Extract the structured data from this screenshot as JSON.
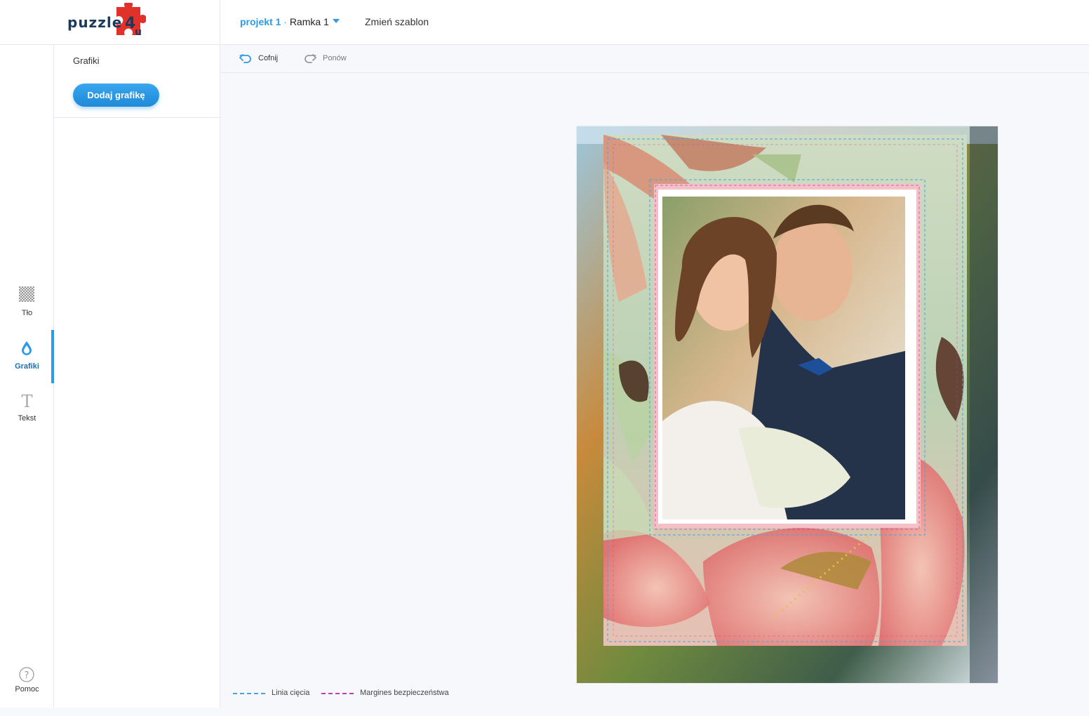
{
  "header": {
    "logo_alt": "puzzle4u",
    "project_label": "projekt 1",
    "separator": " · ",
    "frame_label": "Ramka 1",
    "change_template": "Zmień szablon"
  },
  "toolbar": {
    "undo": "Cofnij",
    "redo": "Ponów"
  },
  "leftnav": {
    "items": [
      {
        "label": "Tło",
        "icon": "checkerboard-icon"
      },
      {
        "label": "Grafiki",
        "icon": "drop-icon",
        "active": true
      },
      {
        "label": "Tekst",
        "icon": "text-icon"
      }
    ],
    "help": "Pomoc"
  },
  "panel": {
    "title": "Grafiki",
    "add_button": "Dodaj grafikę"
  },
  "legend": {
    "cut_line": "Linia cięcia",
    "safety_margin": "Margines bezpieczeństwa"
  },
  "colors": {
    "accent": "#2e9be6",
    "cut_line": "#4aa3df",
    "safety_margin": "#c03bb4"
  }
}
